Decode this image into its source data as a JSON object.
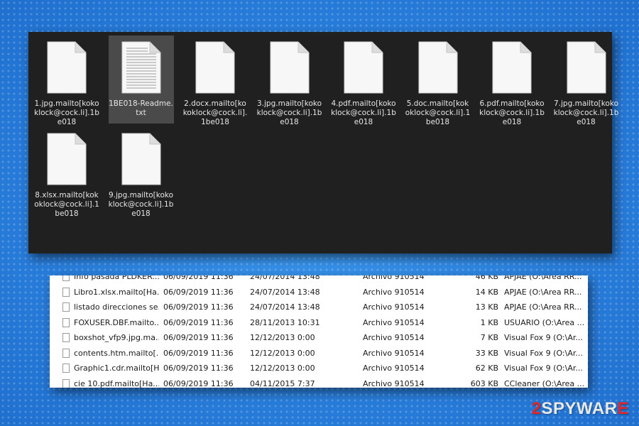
{
  "explorer": {
    "files": [
      {
        "name": "1.jpg.mailto[kokoklock@cock.li].1be018",
        "icon": "blank-file-icon",
        "selected": false
      },
      {
        "name": "1BE018-Readme.txt",
        "icon": "text-file-icon",
        "selected": true
      },
      {
        "name": "2.docx.mailto[kokoklock@cock.li].1be018",
        "icon": "blank-file-icon",
        "selected": false
      },
      {
        "name": "3.jpg.mailto[kokoklock@cock.li].1be018",
        "icon": "blank-file-icon",
        "selected": false
      },
      {
        "name": "4.pdf.mailto[kokoklock@cock.li].1be018",
        "icon": "blank-file-icon",
        "selected": false
      },
      {
        "name": "5.doc.mailto[kokoklock@cock.li].1be018",
        "icon": "blank-file-icon",
        "selected": false
      },
      {
        "name": "6.pdf.mailto[kokoklock@cock.li].1be018",
        "icon": "blank-file-icon",
        "selected": false
      },
      {
        "name": "7.jpg.mailto[kokoklock@cock.li].1be018",
        "icon": "blank-file-icon",
        "selected": false
      },
      {
        "name": "8.xlsx.mailto[kokoklock@cock.li].1be018",
        "icon": "blank-file-icon",
        "selected": false
      },
      {
        "name": "9.jpg.mailto[kokoklock@cock.li].1be018",
        "icon": "blank-file-icon",
        "selected": false
      }
    ]
  },
  "details": {
    "rows": [
      {
        "name": "Info pasada PLDKER...",
        "modified": "06/09/2019 11:36",
        "created": "24/07/2014 13:48",
        "type": "Archivo 910514",
        "size": "46 KB",
        "owner": "APJAE (O:\\Area RR..."
      },
      {
        "name": "Libro1.xlsx.mailto[Ha...",
        "modified": "06/09/2019 11:36",
        "created": "24/07/2014 13:48",
        "type": "Archivo 910514",
        "size": "14 KB",
        "owner": "APJAE (O:\\Area RR..."
      },
      {
        "name": "listado direcciones se...",
        "modified": "06/09/2019 11:36",
        "created": "24/07/2014 13:48",
        "type": "Archivo 910514",
        "size": "13 KB",
        "owner": "APJAE (O:\\Area RR..."
      },
      {
        "name": "FOXUSER.DBF.mailto...",
        "modified": "06/09/2019 11:36",
        "created": "28/11/2013 10:31",
        "type": "Archivo 910514",
        "size": "1 KB",
        "owner": "USUARIO (O:\\Area ..."
      },
      {
        "name": "boxshot_vfp9.jpg.ma...",
        "modified": "06/09/2019 11:36",
        "created": "12/12/2013 0:00",
        "type": "Archivo 910514",
        "size": "7 KB",
        "owner": "Visual Fox 9 (O:\\Ar..."
      },
      {
        "name": "contents.htm.mailto[...",
        "modified": "06/09/2019 11:36",
        "created": "12/12/2013 0:00",
        "type": "Archivo 910514",
        "size": "33 KB",
        "owner": "Visual Fox 9 (O:\\Ar..."
      },
      {
        "name": "Graphic1.cdr.mailto[H...",
        "modified": "06/09/2019 11:36",
        "created": "12/12/2013 0:00",
        "type": "Archivo 910514",
        "size": "62 KB",
        "owner": "Visual Fox 9 (O:\\Ar..."
      },
      {
        "name": "cie 10.pdf.mailto[Ha...",
        "modified": "06/09/2019 11:36",
        "created": "04/11/2015 7:37",
        "type": "Archivo 910514",
        "size": "603 KB",
        "owner": "CCleaner (O:\\Area ..."
      }
    ]
  },
  "watermark": {
    "prefix": "2",
    "brand": "SPYWAR",
    "suffix": "E"
  },
  "colors": {
    "background": "#2f86e0",
    "panel": "#202020",
    "selected": "#4a4a4a",
    "brand_accent": "#e0262b"
  }
}
